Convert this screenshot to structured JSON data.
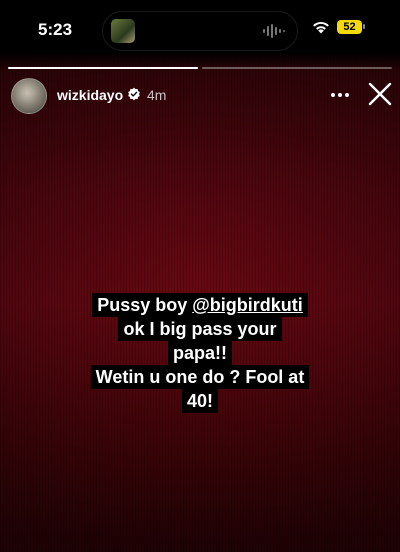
{
  "status_bar": {
    "time": "5:23",
    "battery": "52"
  },
  "progress": [
    1.0,
    0.0
  ],
  "post": {
    "username": "wizkidayo",
    "time_ago": "4m"
  },
  "caption": {
    "prefix": "Pussy boy ",
    "mention": "@bigbirdkuti",
    "rest_line1": "ok I big pass your",
    "rest_line2": "papa!!",
    "line3": "Wetin u one do ? Fool at",
    "line4": "40!"
  },
  "icons": {
    "wifi": "wifi-icon",
    "verified": "verified-badge-icon",
    "more": "more-options-icon",
    "close": "close-icon"
  },
  "colors": {
    "background": "#5a0710",
    "battery": "#f5d90a"
  }
}
